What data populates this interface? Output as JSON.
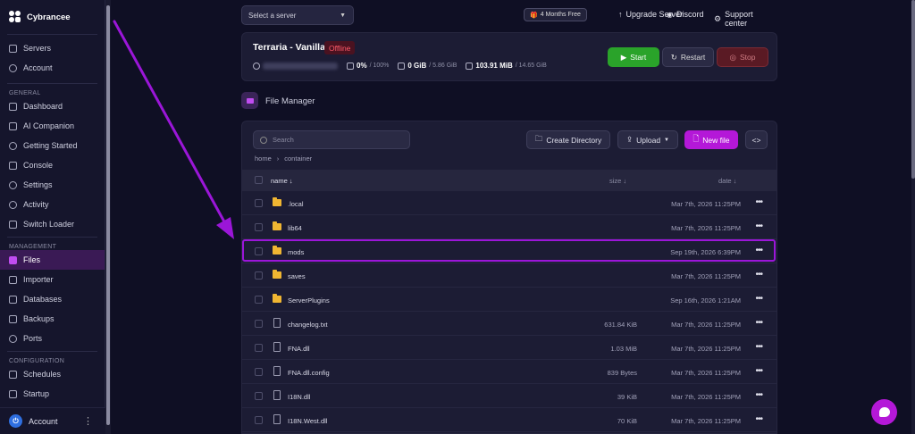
{
  "brand": {
    "name": "Cybrancee"
  },
  "sidebar": {
    "top_items": [
      {
        "label": "Servers",
        "icon": "server-icon"
      },
      {
        "label": "Account",
        "icon": "user-icon"
      }
    ],
    "sections": [
      {
        "title": "GENERAL",
        "items": [
          "Dashboard",
          "AI Companion",
          "Getting Started",
          "Console",
          "Settings",
          "Activity",
          "Switch Loader"
        ]
      },
      {
        "title": "MANAGEMENT",
        "items": [
          "Files",
          "Importer",
          "Databases",
          "Backups",
          "Ports"
        ]
      },
      {
        "title": "CONFIGURATION",
        "items": [
          "Schedules",
          "Startup"
        ]
      }
    ],
    "active_item": "Files",
    "footer": {
      "label": "Account"
    }
  },
  "topbar": {
    "server_select_placeholder": "Select a server",
    "badge": "4 Months Free",
    "links": [
      "Upgrade Server",
      "Discord",
      "Support center"
    ]
  },
  "server": {
    "name": "Terraria - Vanilla",
    "status": "Offline",
    "cpu": "0%",
    "cpu_limit": "/ 100%",
    "memory": "0 GiB",
    "memory_limit": "/ 5.86 GiB",
    "disk": "103.91 MiB",
    "disk_limit": "/ 14.65 GiB",
    "buttons": {
      "start": "Start",
      "restart": "Restart",
      "stop": "Stop"
    }
  },
  "file_manager": {
    "title": "File Manager",
    "search_placeholder": "Search",
    "buttons": {
      "create_directory": "Create Directory",
      "upload": "Upload",
      "new_file": "New file"
    },
    "breadcrumb": [
      "home",
      "container"
    ],
    "columns": {
      "name": "name ↓",
      "size": "size ↓",
      "date": "date ↓"
    },
    "rows": [
      {
        "name": ".local",
        "type": "folder",
        "size": "",
        "date": "Mar 7th, 2026 11:25PM"
      },
      {
        "name": "lib64",
        "type": "folder",
        "size": "",
        "date": "Mar 7th, 2026 11:25PM"
      },
      {
        "name": "mods",
        "type": "folder",
        "size": "",
        "date": "Sep 19th, 2026 6:39PM"
      },
      {
        "name": "saves",
        "type": "folder",
        "size": "",
        "date": "Mar 7th, 2026 11:25PM"
      },
      {
        "name": "ServerPlugins",
        "type": "folder",
        "size": "",
        "date": "Sep 16th, 2026 1:21AM"
      },
      {
        "name": "changelog.txt",
        "type": "file",
        "size": "631.84 KiB",
        "date": "Mar 7th, 2026 11:25PM"
      },
      {
        "name": "FNA.dll",
        "type": "file",
        "size": "1.03 MiB",
        "date": "Mar 7th, 2026 11:25PM"
      },
      {
        "name": "FNA.dll.config",
        "type": "file",
        "size": "839 Bytes",
        "date": "Mar 7th, 2026 11:25PM"
      },
      {
        "name": "I18N.dll",
        "type": "file",
        "size": "39 KiB",
        "date": "Mar 7th, 2026 11:25PM"
      },
      {
        "name": "I18N.West.dll",
        "type": "file",
        "size": "70 KiB",
        "date": "Mar 7th, 2026 11:25PM"
      }
    ],
    "highlighted_row": "mods"
  },
  "colors": {
    "accent": "#b418d8",
    "annotation": "#9b16d8",
    "start": "#2aa32a",
    "offline": "#ff5a6a",
    "folder": "#f0b632"
  }
}
